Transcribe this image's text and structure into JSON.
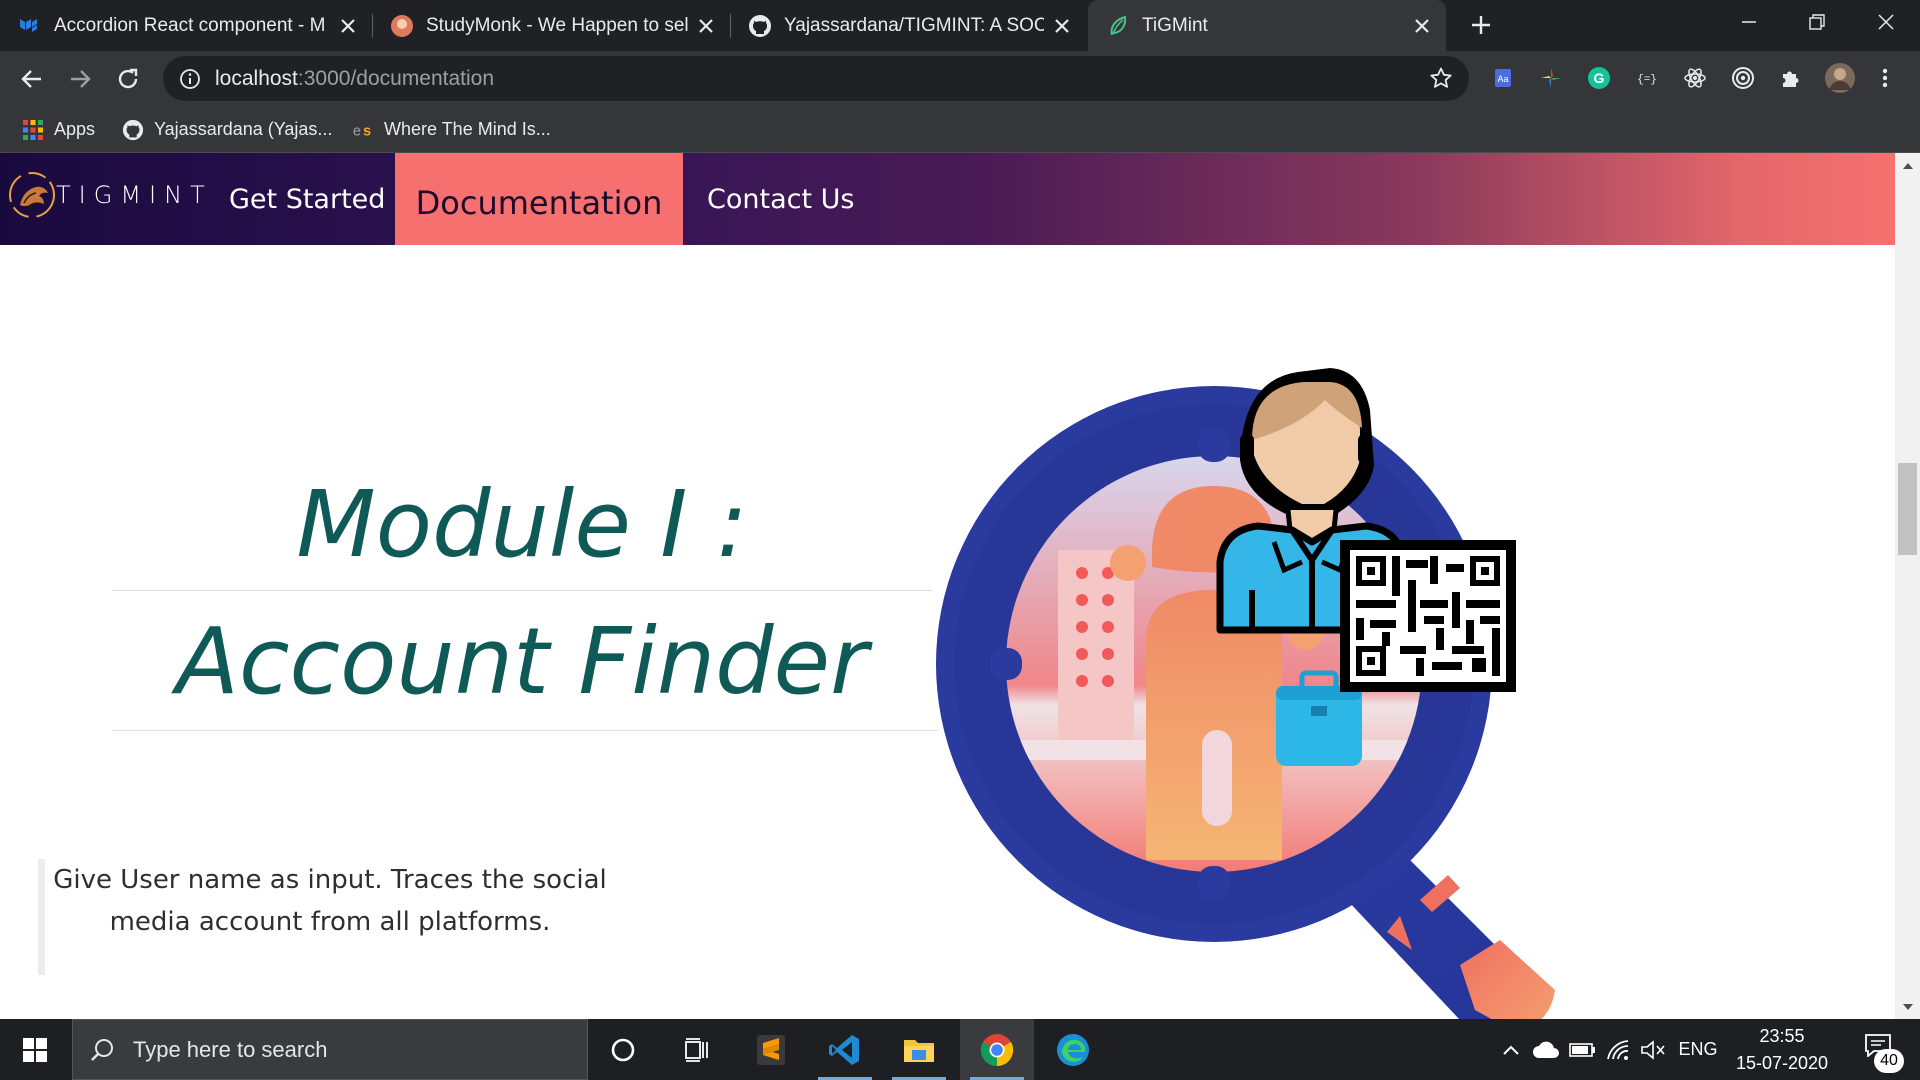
{
  "browser": {
    "tabs": [
      {
        "title": "Accordion React component - M",
        "favicon": "material-ui-icon",
        "active": false
      },
      {
        "title": "StudyMonk - We Happen to sell I",
        "favicon": "studymonk-icon",
        "active": false
      },
      {
        "title": "Yajassardana/TIGMINT: A SOCMI",
        "favicon": "github-icon",
        "active": false
      },
      {
        "title": "TiGMint",
        "favicon": "leaf-icon",
        "active": true
      }
    ],
    "new_tab_icon": "plus-icon",
    "url_host": "localhost",
    "url_path": ":3000/documentation",
    "bookmarks": [
      {
        "label": "Apps",
        "icon": "apps-grid-icon"
      },
      {
        "label": "Yajassardana (Yajas...",
        "icon": "github-icon"
      },
      {
        "label": "Where The Mind Is...",
        "icon": "es-icon"
      }
    ],
    "extensions": [
      "translate-icon",
      "color-picker-icon",
      "grammarly-icon",
      "json-viewer-icon",
      "react-devtools-icon",
      "target-icon",
      "puzzle-icon",
      "profile-avatar"
    ]
  },
  "site": {
    "brand": "TIGMINT",
    "nav": [
      {
        "label": "Get Started",
        "active": false
      },
      {
        "label": "Documentation",
        "active": true
      },
      {
        "label": "Contact Us",
        "active": false
      }
    ],
    "colors": {
      "nav_start": "#190a3e",
      "nav_end": "#f4716f",
      "active_tab": "#f5706e",
      "title": "#0f5956"
    }
  },
  "module": {
    "title_line1": "Module I :",
    "title_line2": "Account Finder",
    "description": "Give User name as input. Traces the social media account from all platforms."
  },
  "taskbar": {
    "search_placeholder": "Type here to search",
    "apps": [
      "cortana-icon",
      "task-view-icon",
      "sublime-text-icon",
      "vscode-icon",
      "file-explorer-icon",
      "chrome-icon",
      "edge-icon"
    ],
    "tray_lang": "ENG",
    "time": "23:55",
    "date": "15-07-2020",
    "notification_count": "40"
  }
}
